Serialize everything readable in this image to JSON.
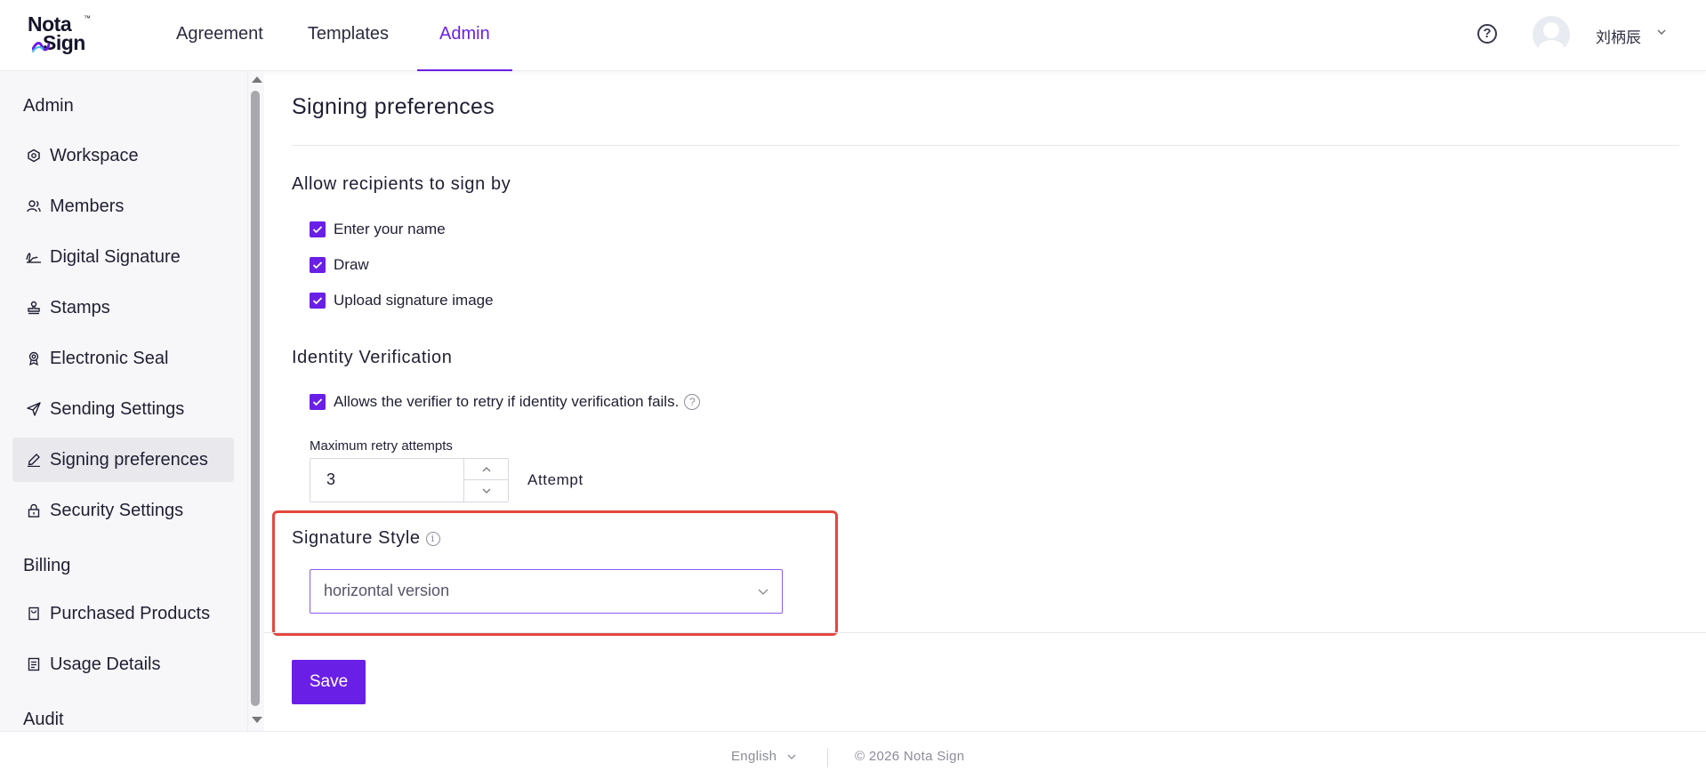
{
  "brand": {
    "line1": "Nota",
    "line2": "Sign",
    "tm": "™",
    "accent": "#6a1fe6"
  },
  "nav": {
    "items": [
      "Agreement",
      "Templates",
      "Admin"
    ],
    "active": "Admin"
  },
  "user": {
    "name": "刘柄辰"
  },
  "sidebar": {
    "sections": [
      {
        "title": "Admin",
        "items": [
          {
            "label": "Workspace",
            "icon": "workspace-icon"
          },
          {
            "label": "Members",
            "icon": "members-icon"
          },
          {
            "label": "Digital Signature",
            "icon": "signature-icon"
          },
          {
            "label": "Stamps",
            "icon": "stamp-icon"
          },
          {
            "label": "Electronic Seal",
            "icon": "seal-icon"
          },
          {
            "label": "Sending Settings",
            "icon": "send-icon"
          },
          {
            "label": "Signing preferences",
            "icon": "pen-icon"
          },
          {
            "label": "Security Settings",
            "icon": "lock-icon"
          }
        ]
      },
      {
        "title": "Billing",
        "items": [
          {
            "label": "Purchased Products",
            "icon": "bag-icon"
          },
          {
            "label": "Usage Details",
            "icon": "document-icon"
          }
        ]
      },
      {
        "title": "Audit",
        "items": []
      }
    ],
    "active": "Signing preferences"
  },
  "main": {
    "title": "Signing preferences",
    "sign_by": {
      "heading": "Allow recipients to sign by",
      "options": [
        {
          "label": "Enter your name",
          "checked": true
        },
        {
          "label": "Draw",
          "checked": true
        },
        {
          "label": "Upload signature image",
          "checked": true
        }
      ]
    },
    "identity": {
      "heading": "Identity Verification",
      "retry_label": "Allows the verifier to retry if identity verification fails.",
      "retry_checked": true,
      "max_label": "Maximum retry attempts",
      "max_value": "3",
      "unit": "Attempt"
    },
    "signature_style": {
      "heading": "Signature Style",
      "value": "horizontal version"
    },
    "save_label": "Save"
  },
  "footer": {
    "language": "English",
    "copyright": "© 2026 Nota Sign"
  }
}
